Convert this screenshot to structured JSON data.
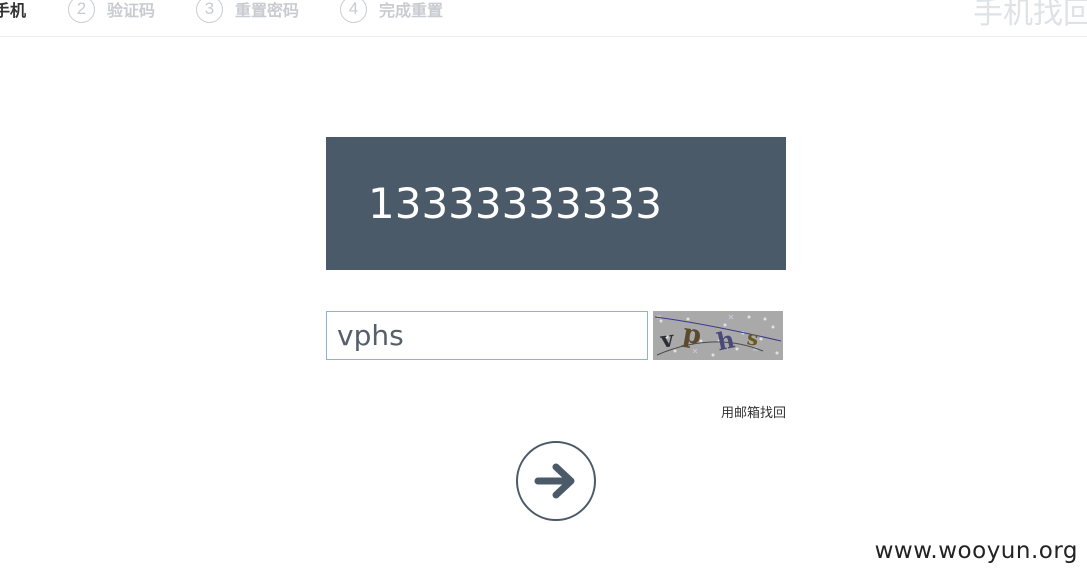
{
  "steps": [
    {
      "num": "",
      "label": "手机"
    },
    {
      "num": "2",
      "label": "验证码"
    },
    {
      "num": "3",
      "label": "重置密码"
    },
    {
      "num": "4",
      "label": "完成重置"
    }
  ],
  "page_title": "手机找回",
  "phone": {
    "number": "13333333333"
  },
  "captcha": {
    "value": "vphs",
    "image_text": "vphs"
  },
  "links": {
    "email_recovery": "用邮箱找回"
  },
  "next_button": {
    "icon": "arrow-right-icon",
    "color": "#4b5a68"
  },
  "watermark": "www.wooyun.org",
  "colors": {
    "panel": "#4b5a68",
    "input_border": "#8fb0d9",
    "step_inactive": "#c8ccd1"
  }
}
